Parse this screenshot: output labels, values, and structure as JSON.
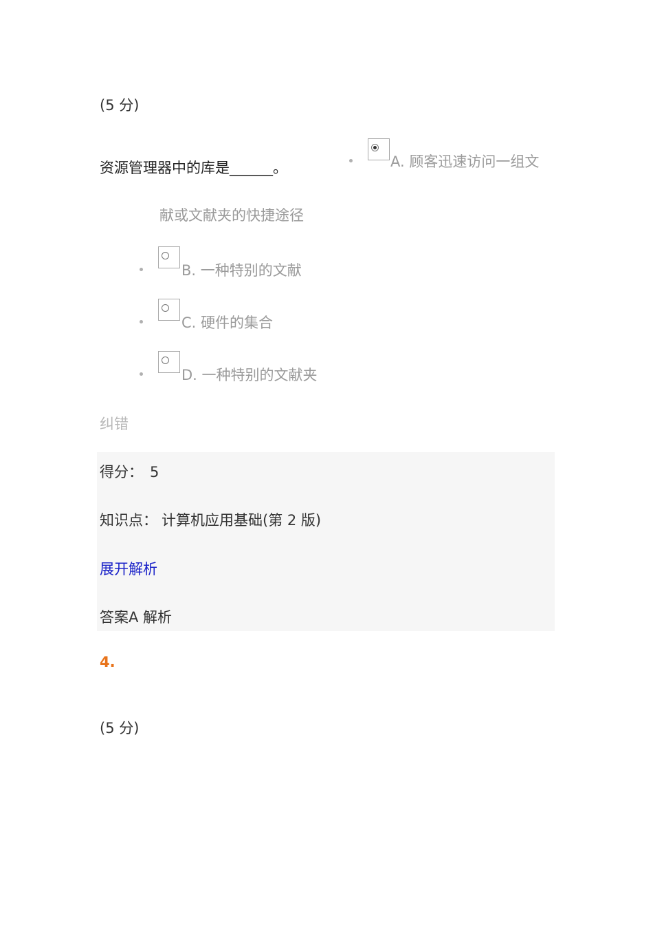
{
  "question": {
    "score": "(5 分)",
    "stem": "资源管理器中的库是______。",
    "options": [
      {
        "label": "A. 顾客迅速访问一组文",
        "label_cont": "献或文献夹的快捷途径",
        "selected": true
      },
      {
        "label": "B. 一种特别的文献",
        "selected": false
      },
      {
        "label": "C. 硬件的集合",
        "selected": false
      },
      {
        "label": "D. 一种特别的文献夹",
        "selected": false
      }
    ],
    "correct_link": "纠错",
    "result": {
      "score_label": "得分：",
      "score_value": "5",
      "knowledge_label": "知识点：",
      "knowledge_value": "计算机应用基础(第 2 版)",
      "expand_label": "展开解析",
      "answer_text": "答案A 解析"
    }
  },
  "next_question": {
    "number": "4.",
    "score": "(5 分)"
  },
  "colors": {
    "accent_number": "#e8731a",
    "link": "#1a22c8",
    "option_text": "#9a9a9a",
    "panel_bg": "#f6f6f6"
  }
}
